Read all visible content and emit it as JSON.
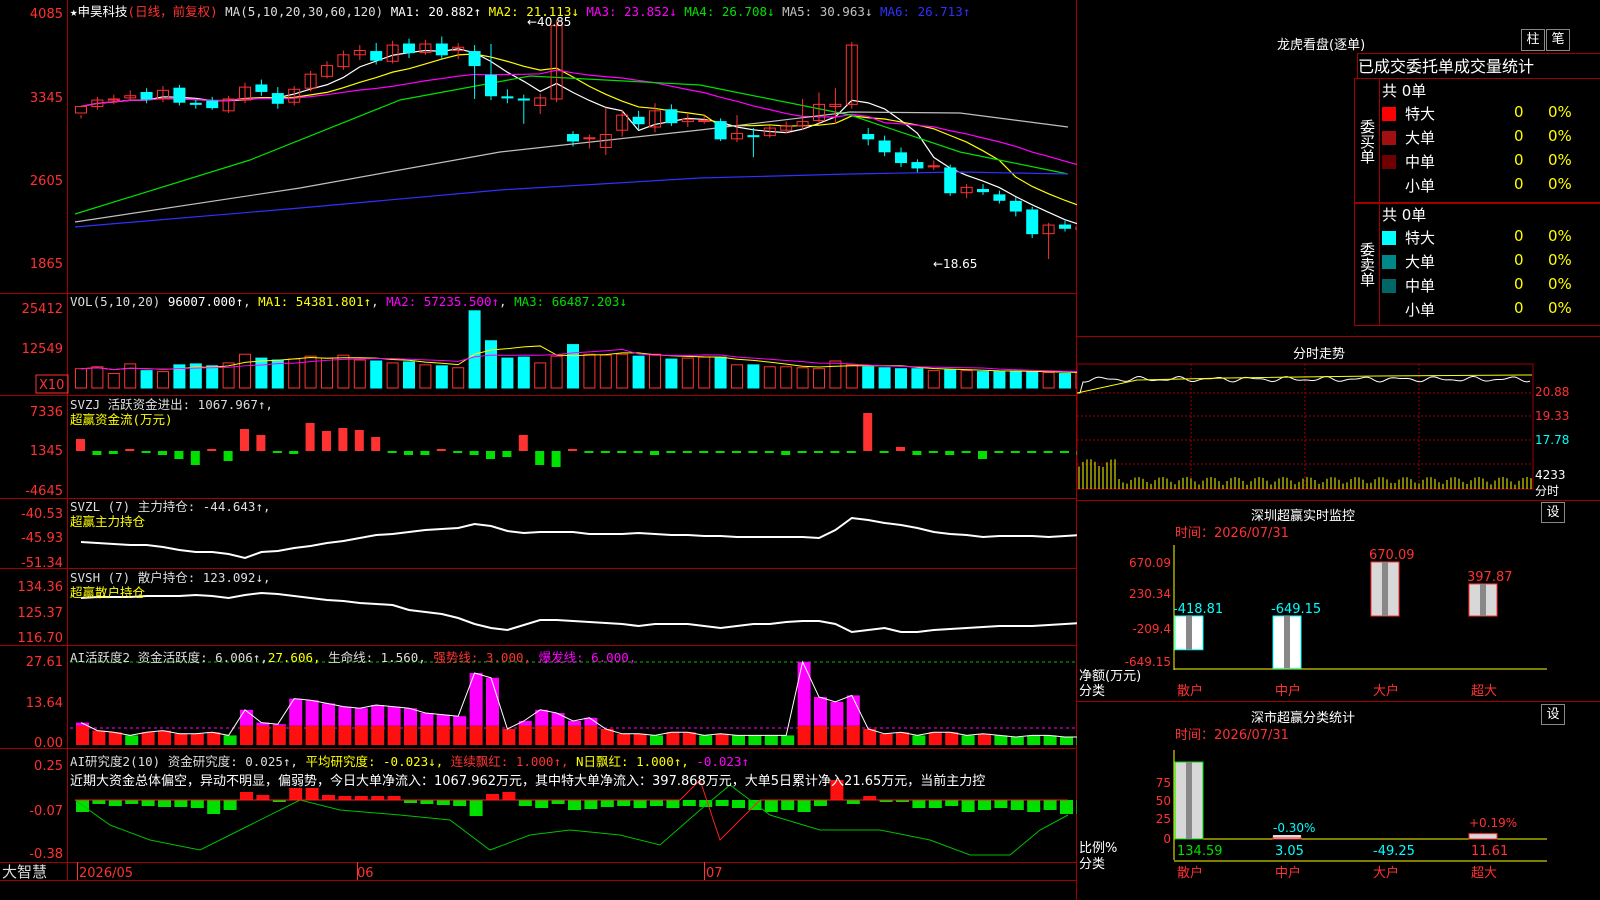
{
  "colors": {
    "up": "#ff3232",
    "down": "#00ffff",
    "green": "#00e000",
    "magenta": "#ff00ff",
    "yellow": "#ffff00",
    "white": "#ffffff",
    "grid": "#a00000",
    "blue": "#3030ff",
    "gray": "#c0c0c0"
  },
  "header": {
    "star": "★",
    "stock": "申昊科技",
    "mode": "(日线，前复权)",
    "ma_title": "MA(5,10,20,30,60,120)",
    "ma": [
      {
        "label": "MA1:",
        "value": "20.882↑",
        "color": "#ffffff"
      },
      {
        "label": "MA2:",
        "value": "21.113↓",
        "color": "#ffff00"
      },
      {
        "label": "MA3:",
        "value": "23.852↓",
        "color": "#ff00ff"
      },
      {
        "label": "MA4:",
        "value": "26.708↓",
        "color": "#00e000"
      },
      {
        "label": "MA5:",
        "value": "30.963↓",
        "color": "#c0c0c0"
      },
      {
        "label": "MA6:",
        "value": "26.713↑",
        "color": "#3030ff"
      }
    ],
    "high_mark": "←40.85",
    "low_mark": "←18.65"
  },
  "axes": {
    "price": [
      "4085",
      "3345",
      "2605",
      "1865"
    ],
    "vol": [
      "25412",
      "12549",
      "X10"
    ],
    "svzj": [
      "7336",
      "1345",
      "-4645"
    ],
    "svzl": [
      "-40.53",
      "-45.93",
      "-51.34"
    ],
    "svsh": [
      "134.36",
      "125.37",
      "116.70"
    ],
    "ai": [
      "27.61",
      "13.64",
      "0.00"
    ],
    "ai2": [
      "0.25",
      "-0.07",
      "-0.38"
    ],
    "dates": [
      "2026/05",
      "06",
      "07"
    ]
  },
  "panels": {
    "vol": {
      "title": "VOL(5,10,20)",
      "val": "96007.000↑",
      "ma1": "MA1: 54381.801↑",
      "ma2": "MA2: 57235.500↑",
      "ma3": "MA3: 66487.203↓"
    },
    "svzj": {
      "title": "SVZJ  活跃资金进出: 1067.967↑,",
      "sub": "超赢资金流(万元)"
    },
    "svzl": {
      "title": "SVZL (7) 主力持仓: -44.643↑,",
      "sub": "超赢主力持仓"
    },
    "svsh": {
      "title": "SVSH (7) 散户持仓: 123.092↓,",
      "sub": "超赢散户持仓"
    },
    "ai": {
      "t1": "AI活跃度2 资金活跃度: 6.006↑,",
      "t2": "27.606,",
      "t3": "生命线: 1.560,",
      "t4": "强势线: 3.000,",
      "t5": "爆发线: 6.000,"
    },
    "ai2": {
      "t1": "AI研究度2(10) 资金研究度: 0.025↑,",
      "t2": "平均研究度: -0.023↓,",
      "t3": "连续飘红: 1.000↑,",
      "t4": "N日飘红: 1.000↑,",
      "t5": "-0.023↑",
      "note": "近期大资金总体偏空，异动不明显，偏弱势，今日大单净流入：1067.962万元，其中特大单净流入：397.868万元，大单5日累计净入21.65万元，当前主力控"
    }
  },
  "brand": "大智慧",
  "right": {
    "lhb_title": "龙虎看盘(逐单)",
    "btn_zhu": "柱",
    "btn_bi": "笔",
    "stat_title": "已成交委托单成交量统计",
    "buy_total": "共 0单",
    "sell_total": "共 0单",
    "buy_label": "委买单",
    "sell_label": "委卖单",
    "buy_rows": [
      {
        "name": "特大",
        "count": "0",
        "pct": "0%",
        "color": "#ff0000"
      },
      {
        "name": "大单",
        "count": "0",
        "pct": "0%",
        "color": "#a01010"
      },
      {
        "name": "中单",
        "count": "0",
        "pct": "0%",
        "color": "#700000"
      },
      {
        "name": "小单",
        "count": "0",
        "pct": "0%",
        "color": "#000000"
      }
    ],
    "sell_rows": [
      {
        "name": "特大",
        "count": "0",
        "pct": "0%",
        "color": "#00ffff"
      },
      {
        "name": "大单",
        "count": "0",
        "pct": "0%",
        "color": "#008888"
      },
      {
        "name": "中单",
        "count": "0",
        "pct": "0%",
        "color": "#006666"
      },
      {
        "name": "小单",
        "count": "0",
        "pct": "0%",
        "color": "#000000"
      }
    ],
    "fenshi_title": "分时走势",
    "fenshi_axis": [
      "20.88",
      "19.33",
      "17.78",
      "4233",
      "分时"
    ],
    "sz_title": "深圳超赢实时监控",
    "sz_set": "设",
    "sz_time": "时间：2026/07/31",
    "sz_axis": [
      "670.09",
      "230.34",
      "-209.4",
      "-649.15"
    ],
    "sz_ylabel": "净额(万元)",
    "sz_xlabel": "分类",
    "sz_cats": [
      "散户",
      "中户",
      "大户",
      "超大"
    ],
    "sz_vals": [
      "-418.81",
      "-649.15",
      "670.09",
      "397.87"
    ],
    "fl_title": "深市超赢分类统计",
    "fl_set": "设",
    "fl_time": "时间：2026/07/31",
    "fl_axis": [
      "75",
      "50",
      "25",
      "0"
    ],
    "fl_ylabel": "比例%",
    "fl_xlabel": "分类",
    "fl_cats": [
      "散户",
      "中户",
      "大户",
      "超大"
    ],
    "fl_vals": [
      "134.59",
      "3.05",
      "-49.25",
      "11.61"
    ],
    "fl_marks": [
      "-0.30%",
      "+0.19%"
    ]
  },
  "chart_data": {
    "type": "candlestick",
    "title": "申昊科技 (日线，前复权)",
    "ylim": [
      18.65,
      40.85
    ],
    "high": 40.85,
    "low": 18.65,
    "dates_visible": [
      "2026/05",
      "06",
      "07"
    ],
    "candles": [
      [
        32.2,
        32.8,
        32.0,
        31.7
      ],
      [
        32.8,
        33.4,
        33.7,
        32.5
      ],
      [
        33.4,
        33.5,
        33.9,
        33.0
      ],
      [
        33.6,
        33.8,
        34.3,
        33.4
      ],
      [
        34.1,
        33.5,
        34.5,
        33.1
      ],
      [
        33.5,
        34.3,
        34.7,
        33.2
      ],
      [
        34.5,
        33.2,
        34.8,
        32.9
      ],
      [
        33.1,
        33.0,
        33.4,
        32.6
      ],
      [
        33.3,
        32.7,
        33.7,
        32.5
      ],
      [
        32.4,
        33.5,
        33.8,
        32.2
      ],
      [
        33.4,
        34.6,
        35.0,
        33.1
      ],
      [
        34.8,
        34.2,
        35.3,
        33.8
      ],
      [
        34.0,
        33.1,
        34.6,
        32.6
      ],
      [
        33.2,
        34.4,
        34.7,
        32.9
      ],
      [
        34.5,
        35.8,
        36.1,
        34.2
      ],
      [
        35.6,
        36.6,
        37.0,
        35.4
      ],
      [
        36.5,
        37.6,
        38.0,
        36.2
      ],
      [
        37.6,
        38.0,
        38.5,
        37.1
      ],
      [
        37.9,
        37.1,
        38.7,
        36.7
      ],
      [
        37.0,
        38.5,
        38.9,
        36.8
      ],
      [
        38.6,
        37.8,
        39.1,
        37.3
      ],
      [
        37.8,
        38.6,
        39.0,
        37.6
      ],
      [
        38.6,
        37.6,
        39.3,
        37.2
      ],
      [
        38.0,
        38.3,
        38.7,
        37.2
      ],
      [
        37.9,
        36.6,
        38.5,
        33.5
      ],
      [
        35.7,
        33.8,
        38.6,
        33.4
      ],
      [
        33.7,
        33.6,
        34.4,
        33.1
      ],
      [
        33.5,
        33.4,
        33.9,
        31.2
      ],
      [
        32.9,
        33.6,
        34.0,
        32.1
      ],
      [
        33.5,
        40.3,
        40.85,
        33.2
      ],
      [
        30.2,
        29.6,
        30.5,
        29.1
      ],
      [
        29.8,
        29.9,
        30.2,
        28.9
      ],
      [
        29.0,
        30.2,
        32.7,
        28.3
      ],
      [
        30.6,
        32.0,
        32.5,
        30.0
      ],
      [
        31.8,
        31.2,
        32.4,
        30.7
      ],
      [
        30.9,
        32.4,
        33.1,
        30.4
      ],
      [
        32.5,
        31.3,
        33.0,
        31.0
      ],
      [
        31.4,
        31.6,
        32.1,
        30.9
      ],
      [
        31.5,
        31.5,
        32.0,
        31.2
      ],
      [
        31.4,
        29.8,
        31.7,
        29.6
      ],
      [
        29.8,
        30.3,
        32.0,
        29.5
      ],
      [
        30.1,
        30.0,
        30.8,
        28.1
      ],
      [
        30.1,
        30.8,
        31.0,
        29.9
      ],
      [
        30.6,
        31.0,
        31.4,
        30.3
      ],
      [
        31.0,
        31.4,
        33.5,
        30.6
      ],
      [
        31.5,
        33.0,
        34.1,
        31.2
      ],
      [
        32.8,
        33.0,
        34.5,
        31.2
      ],
      [
        33.0,
        38.5,
        38.8,
        32.6
      ],
      [
        30.2,
        29.8,
        30.8,
        29.2
      ],
      [
        29.6,
        28.6,
        30.1,
        28.2
      ],
      [
        28.5,
        27.6,
        29.0,
        27.2
      ],
      [
        27.6,
        27.1,
        27.9,
        26.7
      ],
      [
        27.2,
        27.3,
        27.8,
        26.9
      ],
      [
        27.1,
        24.8,
        27.4,
        24.5
      ],
      [
        24.8,
        25.3,
        25.6,
        24.3
      ],
      [
        25.1,
        24.9,
        25.6,
        24.6
      ],
      [
        24.6,
        24.1,
        25.0,
        23.8
      ],
      [
        24.0,
        23.1,
        24.4,
        22.6
      ],
      [
        23.2,
        21.0,
        23.5,
        20.6
      ],
      [
        21.0,
        21.8,
        22.0,
        18.65
      ],
      [
        21.8,
        21.5,
        22.2,
        21.2
      ],
      [
        21.4,
        21.6,
        22.0,
        21.3
      ],
      [
        21.6,
        21.3,
        21.9,
        21.1
      ],
      [
        21.2,
        21.6,
        21.8,
        21.0
      ],
      [
        21.6,
        21.0,
        21.8,
        20.8
      ],
      [
        20.9,
        20.7,
        21.1,
        20.4
      ],
      [
        20.7,
        20.1,
        21.0,
        19.8
      ],
      [
        20.3,
        21.1,
        22.0,
        20.0
      ]
    ],
    "vol_ma": {
      "MA1": 54381.801,
      "MA2": 57235.5,
      "MA3": 66487.203
    },
    "svzj_last": 1067.967,
    "svzl_last": -44.643,
    "svsh_last": 123.092,
    "sz_net": {
      "散户": -418.81,
      "中户": -649.15,
      "大户": 670.09,
      "超大": 397.87
    },
    "fl_ratio": {
      "散户": 134.59,
      "中户": 3.05,
      "大户": -49.25,
      "超大": 11.61
    }
  }
}
